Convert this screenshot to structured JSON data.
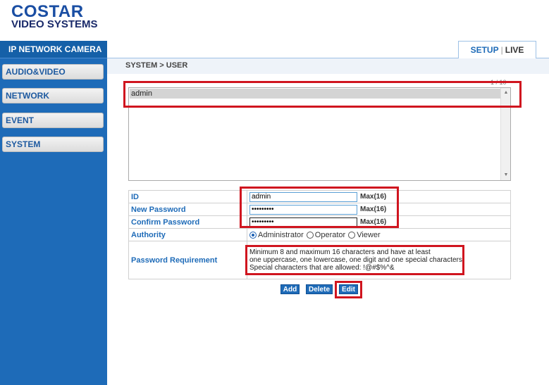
{
  "logo": {
    "line1": "COSTAR",
    "line2": "VIDEO SYSTEMS"
  },
  "sidebar": {
    "title": "IP NETWORK CAMERA",
    "items": [
      {
        "label": "AUDIO&VIDEO"
      },
      {
        "label": "NETWORK"
      },
      {
        "label": "EVENT"
      },
      {
        "label": "SYSTEM"
      }
    ]
  },
  "topnav": {
    "setup": "SETUP",
    "separator": "|",
    "live": "LIVE"
  },
  "breadcrumb": "SYSTEM > USER",
  "user_list": {
    "counter": "1 / 10",
    "users": [
      "admin"
    ]
  },
  "form": {
    "id_label": "ID",
    "id_value": "admin",
    "id_max": "Max(16)",
    "new_password_label": "New Password",
    "new_password_value": "•••••••••",
    "new_password_max": "Max(16)",
    "confirm_password_label": "Confirm Password",
    "confirm_password_value": "•••••••••",
    "confirm_password_max": "Max(16)",
    "authority_label": "Authority",
    "authority_options": [
      "Administrator",
      "Operator",
      "Viewer"
    ],
    "authority_selected": "Administrator",
    "password_requirement_label": "Password Requirement",
    "password_requirement_lines": [
      "Minimum 8 and maximum 16 characters and have at least",
      "one uppercase, one lowercase, one digit and one special characters.",
      "Special characters that are allowed: !@#$%^&"
    ]
  },
  "buttons": {
    "add": "Add",
    "delete": "Delete",
    "edit": "Edit"
  },
  "colors": {
    "accent": "#1e6bb8",
    "highlight": "#d0151f"
  }
}
